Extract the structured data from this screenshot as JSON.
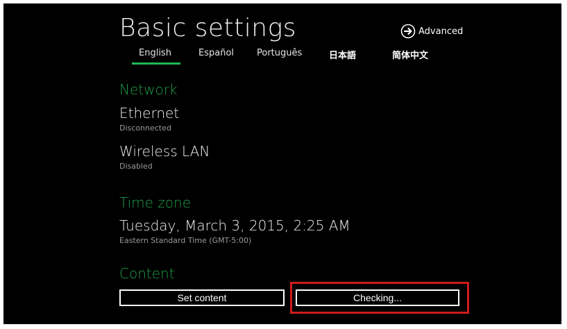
{
  "page": {
    "title": "Basic settings",
    "advanced_label": "Advanced",
    "accent_color": "#1f9e4a",
    "highlight_color": "#d01b1b"
  },
  "languages": [
    {
      "label": "English",
      "selected": true
    },
    {
      "label": "Español",
      "selected": false
    },
    {
      "label": "Português",
      "selected": false
    },
    {
      "label": "日本語",
      "selected": false
    },
    {
      "label": "简体中文",
      "selected": false
    }
  ],
  "network": {
    "heading": "Network",
    "ethernet": {
      "title": "Ethernet",
      "status": "Disconnected"
    },
    "wireless": {
      "title": "Wireless LAN",
      "status": "Disabled"
    }
  },
  "time_zone": {
    "heading": "Time zone",
    "datetime": "Tuesday, March 3, 2015, 2:25 AM",
    "zone": "Eastern Standard Time (GMT-5:00)"
  },
  "content": {
    "heading": "Content",
    "set_content_label": "Set content",
    "checking_label": "Checking..."
  }
}
